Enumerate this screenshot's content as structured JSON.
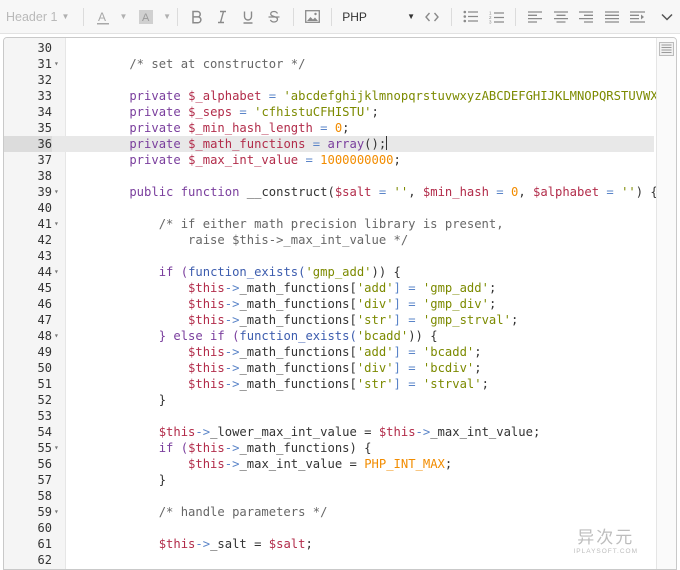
{
  "toolbar": {
    "heading_label": "Header 1",
    "language": "PHP",
    "buttons": [
      "text-color",
      "background-color",
      "bold",
      "italic",
      "underline",
      "strikethrough",
      "image",
      "code",
      "bulleted-list",
      "numbered-list",
      "align-left",
      "align-center",
      "align-right",
      "justify",
      "indent",
      "collapse"
    ]
  },
  "editor": {
    "active_line": 36,
    "lines": [
      {
        "n": "30",
        "fold": "",
        "tokens": []
      },
      {
        "n": "31",
        "fold": "▾",
        "tokens": [
          {
            "t": "    /* set at constructor */",
            "c": "cm"
          }
        ]
      },
      {
        "n": "32",
        "fold": "",
        "tokens": []
      },
      {
        "n": "33",
        "fold": "",
        "tokens": [
          {
            "t": "    private ",
            "c": "kw"
          },
          {
            "t": "$_alphabet",
            "c": "vr"
          },
          {
            "t": " = ",
            "c": "op"
          },
          {
            "t": "'abcdefghijklmnopqrstuvwxyzABCDEFGHIJKLMNOPQRSTUVWXY'",
            "c": "st"
          },
          {
            "t": ";",
            "c": "pl"
          }
        ]
      },
      {
        "n": "34",
        "fold": "",
        "tokens": [
          {
            "t": "    private ",
            "c": "kw"
          },
          {
            "t": "$_seps",
            "c": "vr"
          },
          {
            "t": " = ",
            "c": "op"
          },
          {
            "t": "'cfhistuCFHISTU'",
            "c": "st"
          },
          {
            "t": ";",
            "c": "pl"
          }
        ]
      },
      {
        "n": "35",
        "fold": "",
        "tokens": [
          {
            "t": "    private ",
            "c": "kw"
          },
          {
            "t": "$_min_hash_length",
            "c": "vr"
          },
          {
            "t": " = ",
            "c": "op"
          },
          {
            "t": "0",
            "c": "nm"
          },
          {
            "t": ";",
            "c": "pl"
          }
        ]
      },
      {
        "n": "36",
        "fold": "",
        "tokens": [
          {
            "t": "    private ",
            "c": "kw"
          },
          {
            "t": "$_math_functions",
            "c": "vr"
          },
          {
            "t": " = ",
            "c": "op"
          },
          {
            "t": "array",
            "c": "kw"
          },
          {
            "t": "();",
            "c": "pl"
          }
        ]
      },
      {
        "n": "37",
        "fold": "",
        "tokens": [
          {
            "t": "    private ",
            "c": "kw"
          },
          {
            "t": "$_max_int_value",
            "c": "vr"
          },
          {
            "t": " = ",
            "c": "op"
          },
          {
            "t": "1000000000",
            "c": "nm"
          },
          {
            "t": ";",
            "c": "pl"
          }
        ]
      },
      {
        "n": "38",
        "fold": "",
        "tokens": []
      },
      {
        "n": "39",
        "fold": "▾",
        "tokens": [
          {
            "t": "    public ",
            "c": "kw"
          },
          {
            "t": "function ",
            "c": "kw"
          },
          {
            "t": "__construct(",
            "c": "pl"
          },
          {
            "t": "$salt",
            "c": "vr"
          },
          {
            "t": " = ",
            "c": "op"
          },
          {
            "t": "''",
            "c": "st"
          },
          {
            "t": ", ",
            "c": "pl"
          },
          {
            "t": "$min_hash",
            "c": "vr"
          },
          {
            "t": " = ",
            "c": "op"
          },
          {
            "t": "0",
            "c": "nm"
          },
          {
            "t": ", ",
            "c": "pl"
          },
          {
            "t": "$alphabet",
            "c": "vr"
          },
          {
            "t": " = ",
            "c": "op"
          },
          {
            "t": "''",
            "c": "st"
          },
          {
            "t": ") {",
            "c": "pl"
          }
        ]
      },
      {
        "n": "40",
        "fold": "",
        "tokens": []
      },
      {
        "n": "41",
        "fold": "▾",
        "tokens": [
          {
            "t": "        /* if either math precision library is present,",
            "c": "cm"
          }
        ]
      },
      {
        "n": "42",
        "fold": "",
        "tokens": [
          {
            "t": "            raise $this->_max_int_value */",
            "c": "cm"
          }
        ]
      },
      {
        "n": "43",
        "fold": "",
        "tokens": []
      },
      {
        "n": "44",
        "fold": "▾",
        "tokens": [
          {
            "t": "        if (",
            "c": "kw"
          },
          {
            "t": "function_exists(",
            "c": "fn"
          },
          {
            "t": "'gmp_add'",
            "c": "st"
          },
          {
            "t": ")) {",
            "c": "pl"
          }
        ]
      },
      {
        "n": "45",
        "fold": "",
        "tokens": [
          {
            "t": "            $this",
            "c": "vr"
          },
          {
            "t": "->",
            "c": "op"
          },
          {
            "t": "_math_functions[",
            "c": "pl"
          },
          {
            "t": "'add'",
            "c": "st"
          },
          {
            "t": "] = ",
            "c": "op"
          },
          {
            "t": "'gmp_add'",
            "c": "st"
          },
          {
            "t": ";",
            "c": "pl"
          }
        ]
      },
      {
        "n": "46",
        "fold": "",
        "tokens": [
          {
            "t": "            $this",
            "c": "vr"
          },
          {
            "t": "->",
            "c": "op"
          },
          {
            "t": "_math_functions[",
            "c": "pl"
          },
          {
            "t": "'div'",
            "c": "st"
          },
          {
            "t": "] = ",
            "c": "op"
          },
          {
            "t": "'gmp_div'",
            "c": "st"
          },
          {
            "t": ";",
            "c": "pl"
          }
        ]
      },
      {
        "n": "47",
        "fold": "",
        "tokens": [
          {
            "t": "            $this",
            "c": "vr"
          },
          {
            "t": "->",
            "c": "op"
          },
          {
            "t": "_math_functions[",
            "c": "pl"
          },
          {
            "t": "'str'",
            "c": "st"
          },
          {
            "t": "] = ",
            "c": "op"
          },
          {
            "t": "'gmp_strval'",
            "c": "st"
          },
          {
            "t": ";",
            "c": "pl"
          }
        ]
      },
      {
        "n": "48",
        "fold": "▾",
        "tokens": [
          {
            "t": "        } else if (",
            "c": "kw"
          },
          {
            "t": "function_exists(",
            "c": "fn"
          },
          {
            "t": "'bcadd'",
            "c": "st"
          },
          {
            "t": ")) {",
            "c": "pl"
          }
        ]
      },
      {
        "n": "49",
        "fold": "",
        "tokens": [
          {
            "t": "            $this",
            "c": "vr"
          },
          {
            "t": "->",
            "c": "op"
          },
          {
            "t": "_math_functions[",
            "c": "pl"
          },
          {
            "t": "'add'",
            "c": "st"
          },
          {
            "t": "] = ",
            "c": "op"
          },
          {
            "t": "'bcadd'",
            "c": "st"
          },
          {
            "t": ";",
            "c": "pl"
          }
        ]
      },
      {
        "n": "50",
        "fold": "",
        "tokens": [
          {
            "t": "            $this",
            "c": "vr"
          },
          {
            "t": "->",
            "c": "op"
          },
          {
            "t": "_math_functions[",
            "c": "pl"
          },
          {
            "t": "'div'",
            "c": "st"
          },
          {
            "t": "] = ",
            "c": "op"
          },
          {
            "t": "'bcdiv'",
            "c": "st"
          },
          {
            "t": ";",
            "c": "pl"
          }
        ]
      },
      {
        "n": "51",
        "fold": "",
        "tokens": [
          {
            "t": "            $this",
            "c": "vr"
          },
          {
            "t": "->",
            "c": "op"
          },
          {
            "t": "_math_functions[",
            "c": "pl"
          },
          {
            "t": "'str'",
            "c": "st"
          },
          {
            "t": "] = ",
            "c": "op"
          },
          {
            "t": "'strval'",
            "c": "st"
          },
          {
            "t": ";",
            "c": "pl"
          }
        ]
      },
      {
        "n": "52",
        "fold": "",
        "tokens": [
          {
            "t": "        }",
            "c": "pl"
          }
        ]
      },
      {
        "n": "53",
        "fold": "",
        "tokens": []
      },
      {
        "n": "54",
        "fold": "",
        "tokens": [
          {
            "t": "        $this",
            "c": "vr"
          },
          {
            "t": "->",
            "c": "op"
          },
          {
            "t": "_lower_max_int_value = ",
            "c": "pl"
          },
          {
            "t": "$this",
            "c": "vr"
          },
          {
            "t": "->",
            "c": "op"
          },
          {
            "t": "_max_int_value;",
            "c": "pl"
          }
        ]
      },
      {
        "n": "55",
        "fold": "▾",
        "tokens": [
          {
            "t": "        if (",
            "c": "kw"
          },
          {
            "t": "$this",
            "c": "vr"
          },
          {
            "t": "->",
            "c": "op"
          },
          {
            "t": "_math_functions) {",
            "c": "pl"
          }
        ]
      },
      {
        "n": "56",
        "fold": "",
        "tokens": [
          {
            "t": "            $this",
            "c": "vr"
          },
          {
            "t": "->",
            "c": "op"
          },
          {
            "t": "_max_int_value = ",
            "c": "pl"
          },
          {
            "t": "PHP_INT_MAX",
            "c": "nm"
          },
          {
            "t": ";",
            "c": "pl"
          }
        ]
      },
      {
        "n": "57",
        "fold": "",
        "tokens": [
          {
            "t": "        }",
            "c": "pl"
          }
        ]
      },
      {
        "n": "58",
        "fold": "",
        "tokens": []
      },
      {
        "n": "59",
        "fold": "▾",
        "tokens": [
          {
            "t": "        /* handle parameters */",
            "c": "cm"
          }
        ]
      },
      {
        "n": "60",
        "fold": "",
        "tokens": []
      },
      {
        "n": "61",
        "fold": "",
        "tokens": [
          {
            "t": "        $this",
            "c": "vr"
          },
          {
            "t": "->",
            "c": "op"
          },
          {
            "t": "_salt = ",
            "c": "pl"
          },
          {
            "t": "$salt",
            "c": "vr"
          },
          {
            "t": ";",
            "c": "pl"
          }
        ]
      },
      {
        "n": "62",
        "fold": "",
        "tokens": []
      }
    ]
  },
  "watermark": {
    "main": "异次元",
    "sub": "IPLAYSOFT.COM"
  }
}
